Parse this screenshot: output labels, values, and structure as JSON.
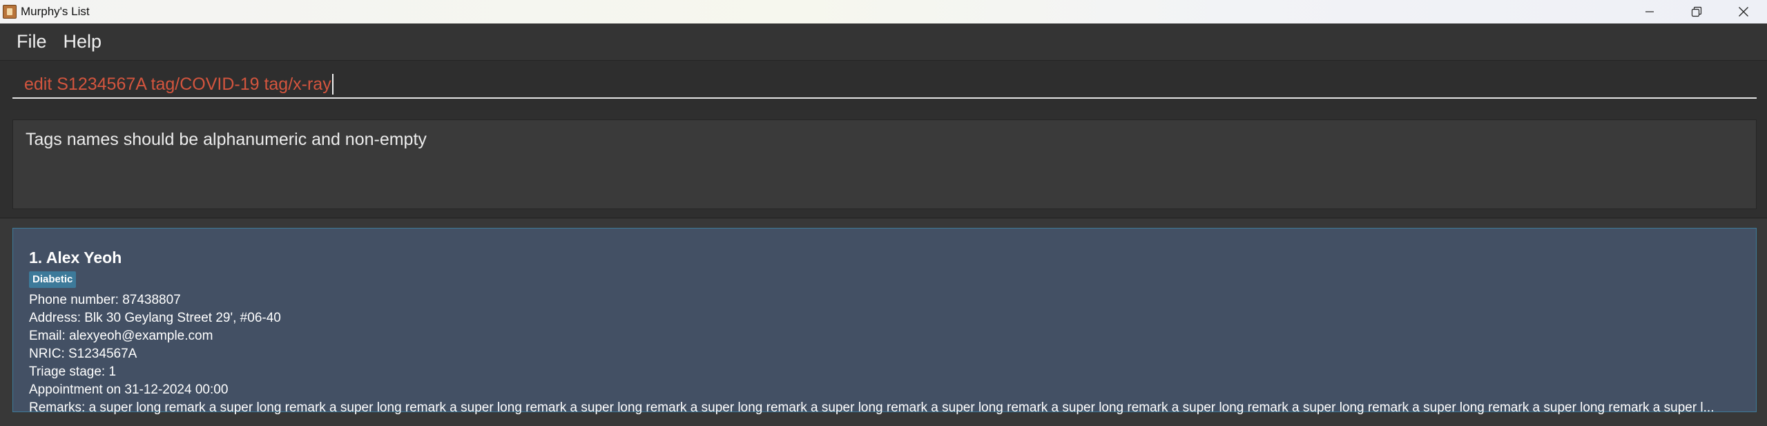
{
  "window": {
    "title": "Murphy's List",
    "controls": [
      "minimize-icon",
      "restore-icon",
      "close-icon"
    ]
  },
  "menu": {
    "items": [
      "File",
      "Help"
    ]
  },
  "command": {
    "value": "edit S1234567A tag/COVID-19 tag/x-ray",
    "text_color": "#d4553e"
  },
  "result": {
    "message": "Tags names should be alphanumeric and non-empty"
  },
  "persons": [
    {
      "index_name": "1. Alex Yeoh",
      "tags": [
        "Diabetic"
      ],
      "phone": "Phone number: 87438807",
      "address": "Address: Blk 30 Geylang Street 29', #06-40",
      "email": "Email: alexyeoh@example.com",
      "nric": "NRIC: S1234567A",
      "triage": "Triage stage: 1",
      "appointment": "Appointment on 31-12-2024 00:00",
      "remarks": "Remarks: a super long remark a super long remark a super long remark a super long remark a super long remark a super long remark a super long remark a super long remark a super long remark a super long remark a super long remark a super long remark a super long remark a super l..."
    }
  ],
  "colors": {
    "card_background": "#435064",
    "card_border": "#3e7a98",
    "tag_background": "#3d7a9a",
    "app_background": "#2f2f2f"
  }
}
